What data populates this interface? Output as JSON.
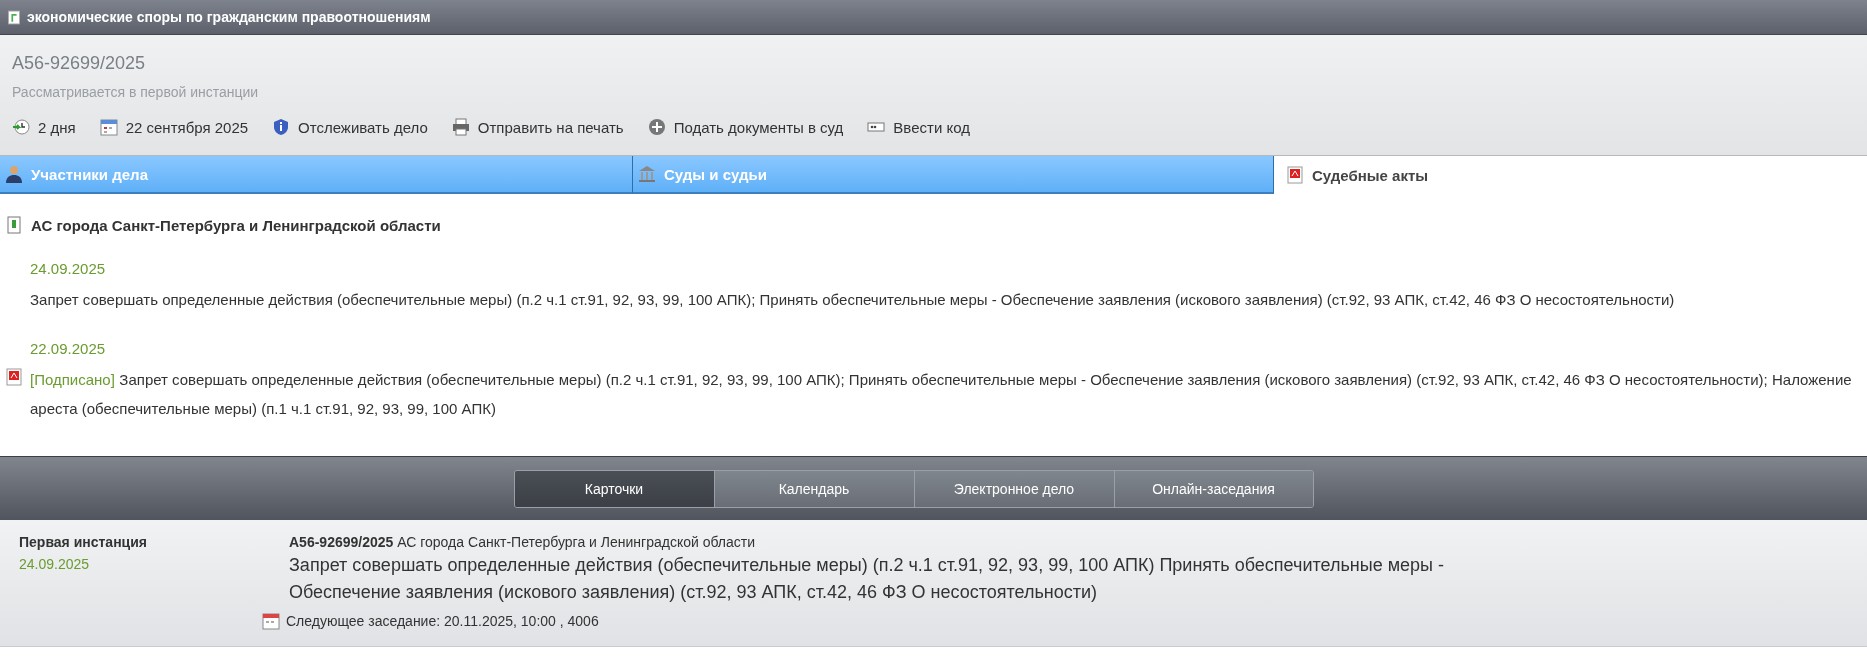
{
  "header": {
    "title": "экономические споры по гражданским правоотношениям"
  },
  "case": {
    "number": "А56-92699/2025",
    "status": "Рассматривается в первой инстанции"
  },
  "toolbar": [
    {
      "label": "2 дня"
    },
    {
      "label": "22 сентября 2025"
    },
    {
      "label": "Отслеживать дело"
    },
    {
      "label": "Отправить на печать"
    },
    {
      "label": "Подать документы в суд"
    },
    {
      "label": "Ввести код"
    }
  ],
  "tabs": [
    {
      "label": "Участники дела",
      "selected": false
    },
    {
      "label": "Суды и судьи",
      "selected": false
    },
    {
      "label": "Судебные акты",
      "selected": true
    }
  ],
  "acts": {
    "court": "АС города Санкт-Петербурга и Ленинградской области",
    "items": [
      {
        "date": "24.09.2025",
        "text": "Запрет совершать определенные действия (обеспечительные меры) (п.2 ч.1 ст.91, 92, 93, 99, 100 АПК); Принять обеспечительные меры - Обеспечение заявления (искового заявления) (ст.92, 93 АПК, ст.42, 46 ФЗ О несостоятельности)"
      },
      {
        "date": "22.09.2025",
        "status": "[Подписано]",
        "text": "Запрет совершать определенные действия (обеспечительные меры) (п.2 ч.1 ст.91, 92, 93, 99, 100 АПК); Принять обеспечительные меры - Обеспечение заявления (искового заявления) (ст.92, 93 АПК, ст.42, 46 ФЗ О несостоятельности); Наложение ареста (обеспечительные меры) (п.1 ч.1 ст.91, 92, 93, 99, 100 АПК)"
      }
    ]
  },
  "bottom_tabs": [
    {
      "label": "Карточки",
      "selected": true
    },
    {
      "label": "Календарь",
      "selected": false
    },
    {
      "label": "Электронное дело",
      "selected": false
    },
    {
      "label": "Онлайн-заседания",
      "selected": false
    }
  ],
  "card": {
    "instance": "Первая инстанция",
    "date": "24.09.2025",
    "heading": "**А56-92699/2025** АС города Санкт-Петербурга и Ленинградской области",
    "description": "Запрет совершать определенные действия (обеспечительные меры) (п.2 ч.1 ст.91, 92, 93, 99, 100 АПК) Принять обеспечительные меры - Обеспечение заявления (искового заявления) (ст.92, 93 АПК, ст.42, 46 ФЗ О несостоятельности)",
    "next_session": "Следующее заседание: 20.11.2025, 10:00 , 4006"
  }
}
